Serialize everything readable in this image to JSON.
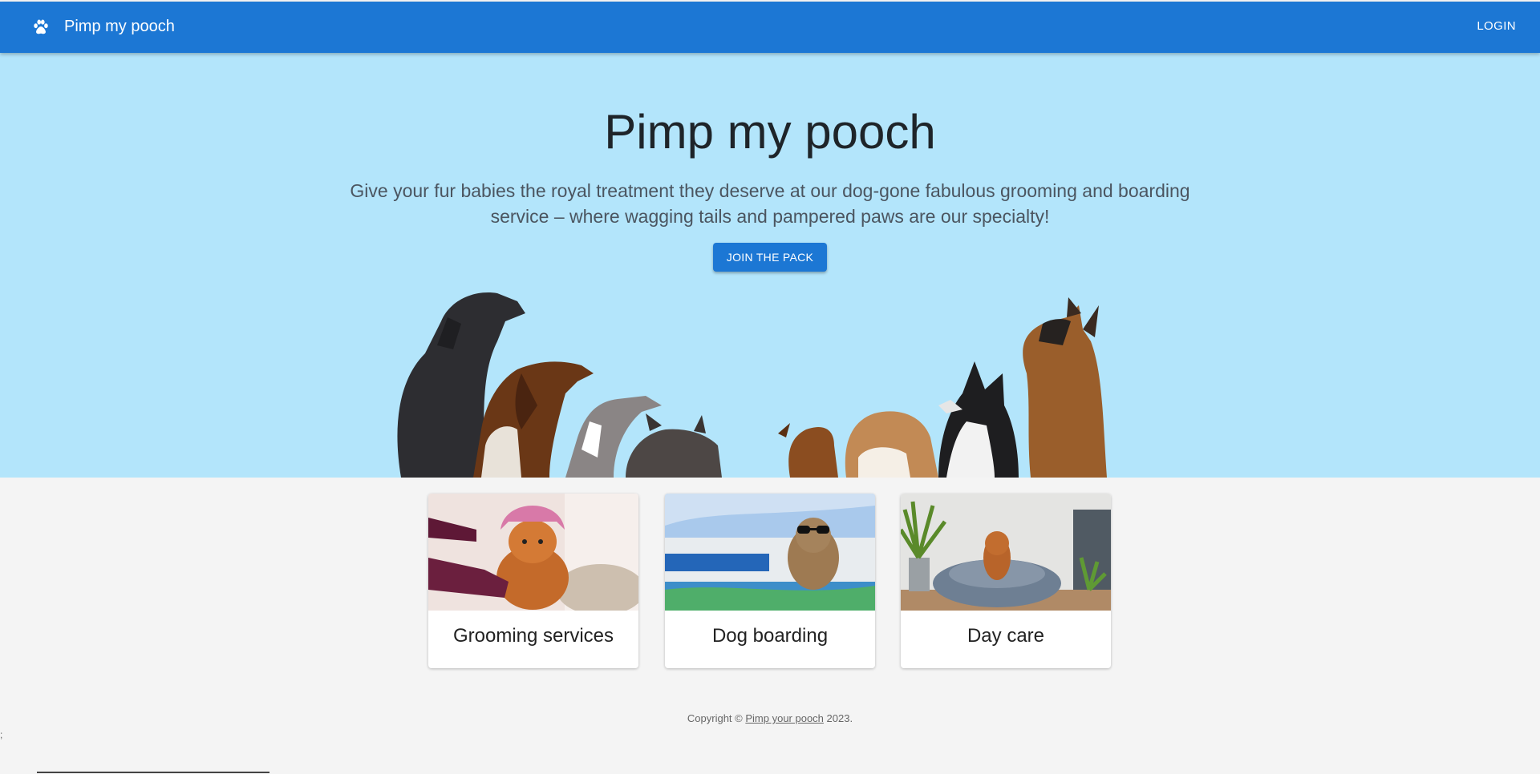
{
  "appbar": {
    "brand": "Pimp my pooch",
    "login_label": "LOGIN",
    "icon": "paw-icon",
    "color": "#1c77d4"
  },
  "hero": {
    "title": "Pimp my pooch",
    "subtitle": "Give your fur babies the royal treatment they deserve at our dog-gone fabulous grooming and boarding service – where wagging tails and pampered paws are our specialty!",
    "cta_label": "JOIN THE PACK",
    "background": "#b3e5fb"
  },
  "cards": [
    {
      "label": "Grooming services"
    },
    {
      "label": "Dog boarding"
    },
    {
      "label": "Day care"
    }
  ],
  "footer": {
    "prefix": "Copyright © ",
    "link": "Pimp your pooch",
    "suffix": " 2023."
  },
  "stray_text": ";"
}
